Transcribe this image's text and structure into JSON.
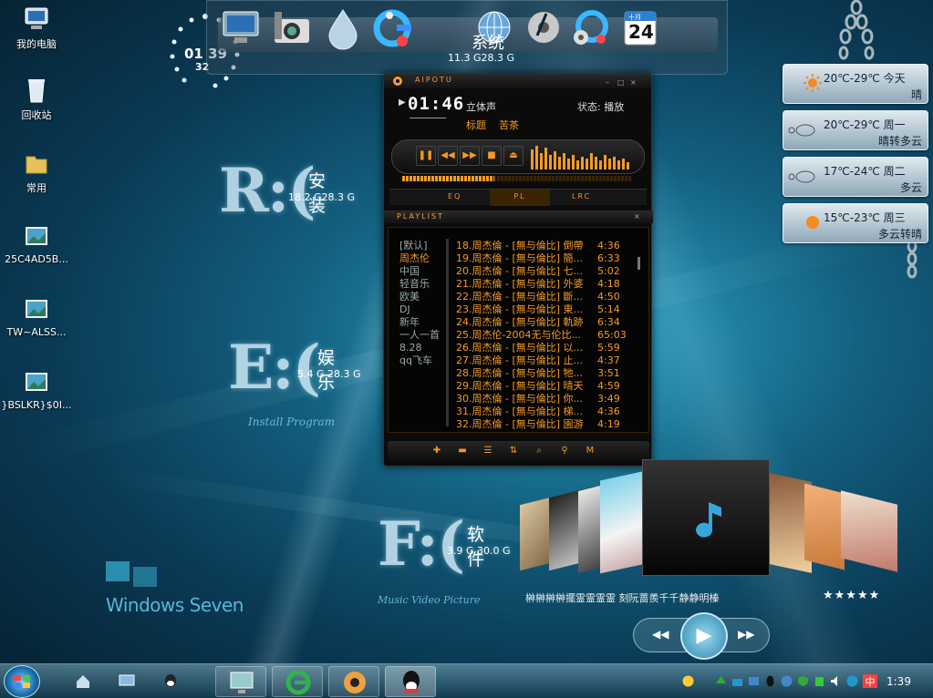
{
  "desktop_icons": [
    {
      "label": "我的电脑",
      "icon": "computer-icon"
    },
    {
      "label": "回收站",
      "icon": "recycle-bin-icon"
    },
    {
      "label": "常用",
      "icon": "folder-icon"
    },
    {
      "label": "25C4AD5B...",
      "icon": "image-file-icon"
    },
    {
      "label": "TW~ALSS...",
      "icon": "image-file-icon"
    },
    {
      "label": "}BSLKR}$0I...",
      "icon": "image-file-icon"
    }
  ],
  "clock": {
    "hm": "01 39",
    "sec": "32"
  },
  "drives": [
    {
      "letter": "R:(",
      "name": "安装",
      "size": "18.2 G28.3 G"
    },
    {
      "letter": "E:(",
      "name": "娱乐",
      "size": "5.4 G 28.3 G",
      "caption": "Install Program"
    },
    {
      "letter": "F:(",
      "name": "软件",
      "size": "3.9 G 30.0 G",
      "caption": "Music Video Picture"
    },
    {
      "name": "系统",
      "size": "11.3 G28.3 G"
    }
  ],
  "calendar": {
    "day": "24",
    "month": "十月"
  },
  "brand": "Windows Seven",
  "player": {
    "title": "AIPOTU",
    "time": "01:46",
    "mode": "立体声",
    "status": "状态: 播放",
    "song_label": "标题",
    "song": "苦茶",
    "tabs": [
      "EQ",
      "PL",
      "LRC"
    ],
    "playlist_title": "PLAYLIST",
    "categories": [
      "[默认]",
      "周杰伦",
      "中国",
      "轻音乐",
      "欧美",
      "DJ",
      "新年",
      "一人一首",
      "8.28",
      "qq飞车"
    ],
    "selected_category": 1,
    "tracks": [
      {
        "t": "18.周杰倫 - [無与倫比] 倒帶",
        "d": "4:36"
      },
      {
        "t": "19.周杰倫 - [無与倫比] 簡...",
        "d": "6:33"
      },
      {
        "t": "20.周杰倫 - [無与倫比] 七...",
        "d": "5:02"
      },
      {
        "t": "21.周杰倫 - [無与倫比] 外婆",
        "d": "4:18"
      },
      {
        "t": "22.周杰倫 - [無与倫比] 斷...",
        "d": "4:50"
      },
      {
        "t": "23.周杰倫 - [無与倫比] 東...",
        "d": "5:14"
      },
      {
        "t": "24.周杰倫 - [無与倫比] 軌跡",
        "d": "6:34"
      },
      {
        "t": "25.周杰伦-2004无与伦比...",
        "d": "65:03"
      },
      {
        "t": "26.周杰倫 - [無与倫比] 以...",
        "d": "5:59"
      },
      {
        "t": "27.周杰倫 - [無与倫比] 止...",
        "d": "4:37"
      },
      {
        "t": "28.周杰倫 - [無与倫比] 牠...",
        "d": "3:51"
      },
      {
        "t": "29.周杰倫 - [無与倫比] 晴天",
        "d": "4:59"
      },
      {
        "t": "30.周杰倫 - [無与倫比] 你...",
        "d": "3:49"
      },
      {
        "t": "31.周杰倫 - [無与倫比] 梯...",
        "d": "4:36"
      },
      {
        "t": "32.周杰倫 - [無与倫比] 園游",
        "d": "4:19"
      }
    ]
  },
  "weather": [
    {
      "temp": "20℃-29℃",
      "day": "今天",
      "desc": "晴",
      "icon": "sun-icon"
    },
    {
      "temp": "20℃-29℃",
      "day": "周一",
      "desc": "晴转多云",
      "icon": "cloud-icon"
    },
    {
      "temp": "17℃-24℃",
      "day": "周二",
      "desc": "多云",
      "icon": "cloud-icon"
    },
    {
      "temp": "15℃-23℃",
      "day": "周三",
      "desc": "多云转晴",
      "icon": "sun-icon"
    }
  ],
  "coverflow": {
    "caption": "榊榊榊榊擺霊霊霊霊 刻阮蔷羨千千静静明榛",
    "rating": "★★★★★"
  },
  "taskbar": {
    "time": "1:39",
    "ime": "中"
  }
}
